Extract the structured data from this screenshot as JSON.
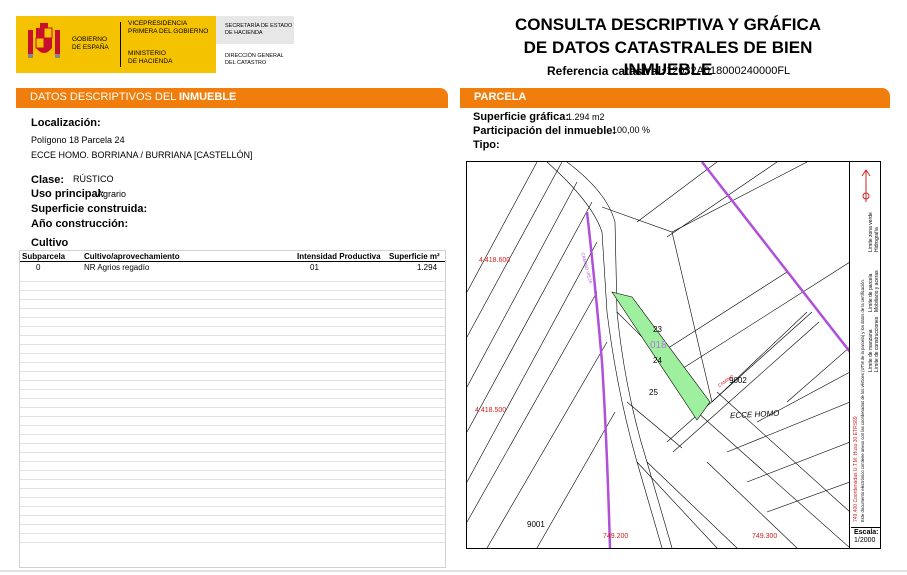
{
  "header": {
    "logo_col1": [
      "GOBIERNO",
      "DE ESPAÑA"
    ],
    "logo_col2_top": [
      "VICEPRESIDENCIA",
      "PRIMERA DEL GOBIERNO"
    ],
    "logo_col2_bottom": [
      "MINISTERIO",
      "DE HACIENDA"
    ],
    "logo_col3_top": [
      "SECRETARÍA DE ESTADO",
      "DE HACIENDA"
    ],
    "logo_col3_bottom": [
      "DIRECCIÓN GENERAL",
      "DEL CATASTRO"
    ],
    "title_line1": "CONSULTA DESCRIPTIVA Y GRÁFICA",
    "title_line2": "DE DATOS CATASTRALES DE BIEN INMUEBLE",
    "ref_label": "Referencia catastral:",
    "ref_value": "12032A018000240000FL"
  },
  "left": {
    "section_title_a": "DATOS DESCRIPTIVOS DEL ",
    "section_title_b": "INMUEBLE",
    "localizacion_label": "Localización:",
    "localizacion_line1": "Polígono 18 Parcela 24",
    "localizacion_line2": "ECCE HOMO. BORRIANA / BURRIANA [CASTELLÓN]",
    "clase_label": "Clase:",
    "clase_value": "RÚSTICO",
    "uso_label": "Uso principal:",
    "uso_value": "Agrario",
    "superficie_label": "Superficie construida:",
    "anio_label": "Año construcción:",
    "cultivo_title": "Cultivo",
    "table_headers": [
      "Subparcela",
      "Cultivo/aprovechamiento",
      "Intensidad Productiva",
      "Superficie m²"
    ],
    "table_rows": [
      [
        "0",
        "NR Agrios regadío",
        "01",
        "1.294"
      ]
    ]
  },
  "right": {
    "section_title": "PARCELA",
    "sup_grafica_label": "Superficie gráfica:",
    "sup_grafica_value": "1.294 m2",
    "participacion_label": "Participación del inmueble:",
    "participacion_value": "100,00 %",
    "tipo_label": "Tipo:"
  },
  "map": {
    "coord_y1": "4.418.600",
    "coord_y2": "4.418.500",
    "coord_x1": "749.200",
    "coord_x2": "749.300",
    "parcel_labels": [
      "23",
      "018",
      "24",
      "25",
      "9001",
      "9002"
    ],
    "place_name": "ECCE HOMO",
    "road_label": "CAMINO VIEJA",
    "road_label2": "CAMINO",
    "legend_lines": [
      "Límite de manzana",
      "Límite de parcela",
      "Límite de construcciones",
      "Mobiliario y aceras",
      "Límite zona verde",
      "Hidrografía"
    ],
    "legend_note": "Este documento electrónico contiene anexo con las coordenadas de los vértices (UTM de la parcela) y los datos de la certificación.",
    "legend_coords": "749.400 Coordenadas U.T.M. Huso 30 ETRS89",
    "scale_label": "Escala:",
    "scale_value": "1/2000",
    "colors": {
      "accent": "#f07d0c",
      "parcel_fill": "#9ef09e",
      "road": "#b04fd9",
      "coord_text": "#d22222"
    }
  }
}
